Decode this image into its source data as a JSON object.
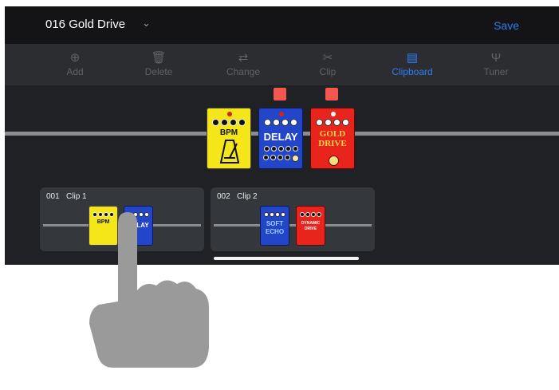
{
  "header": {
    "preset_title": "016 Gold Drive",
    "dropdown_glyph": "⌄",
    "save_label": "Save"
  },
  "toolbar": {
    "items": [
      {
        "label": "Add",
        "icon": "plus-circle-icon",
        "glyph": "⊕",
        "active": false
      },
      {
        "label": "Delete",
        "icon": "trash-icon",
        "glyph": "🗑",
        "active": false
      },
      {
        "label": "Change",
        "icon": "swap-icon",
        "glyph": "⇄",
        "active": false
      },
      {
        "label": "Clip",
        "icon": "scissors-icon",
        "glyph": "✂",
        "active": false
      },
      {
        "label": "Clipboard",
        "icon": "clipboard-icon",
        "glyph": "▤",
        "active": true
      },
      {
        "label": "Tuner",
        "icon": "tuning-fork-icon",
        "glyph": "Ψ",
        "active": false
      }
    ]
  },
  "chain": {
    "pedals": [
      {
        "name": "BPM",
        "color": "#f5e61a",
        "icon": "metronome-icon"
      },
      {
        "name": "DELAY",
        "color": "#2245c9"
      },
      {
        "name": "GOLD DRIVE",
        "color": "#e8241c"
      }
    ]
  },
  "clipboard": {
    "clips": [
      {
        "number": "001",
        "name": "Clip 1",
        "pedals": [
          "BPM",
          "DELAY"
        ]
      },
      {
        "number": "002",
        "name": "Clip 2",
        "pedals": [
          "SOFT ECHO",
          "DYNAMIC DRIVE"
        ]
      }
    ]
  },
  "colors": {
    "accent": "#2f7df6",
    "background": "#202124",
    "selection": "#f4574f"
  }
}
